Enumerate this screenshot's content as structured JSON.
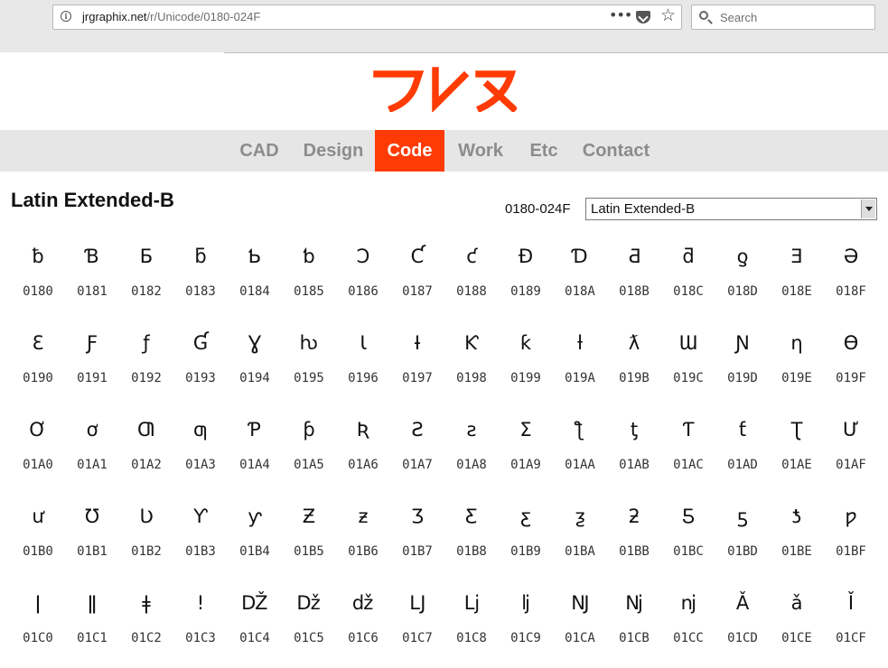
{
  "browser": {
    "url_host": "jrgraphix.net",
    "url_path": "/r/Unicode/0180-024F",
    "search_placeholder": "Search"
  },
  "brand": {
    "logo_text": "フレメ",
    "accent_color": "#ff3b05"
  },
  "nav": {
    "items": [
      {
        "label": "CAD"
      },
      {
        "label": "Design"
      },
      {
        "label": "Code"
      },
      {
        "label": "Work"
      },
      {
        "label": "Etc"
      },
      {
        "label": "Contact"
      }
    ],
    "active": "Code"
  },
  "page": {
    "title": "Latin Extended-B",
    "range_label": "0180-024F",
    "selected_block": "Latin Extended-B"
  },
  "chars": [
    {
      "glyph": "ƀ",
      "code": "0180"
    },
    {
      "glyph": "Ɓ",
      "code": "0181"
    },
    {
      "glyph": "Ƃ",
      "code": "0182"
    },
    {
      "glyph": "ƃ",
      "code": "0183"
    },
    {
      "glyph": "Ƅ",
      "code": "0184"
    },
    {
      "glyph": "ƅ",
      "code": "0185"
    },
    {
      "glyph": "Ɔ",
      "code": "0186"
    },
    {
      "glyph": "Ƈ",
      "code": "0187"
    },
    {
      "glyph": "ƈ",
      "code": "0188"
    },
    {
      "glyph": "Ɖ",
      "code": "0189"
    },
    {
      "glyph": "Ɗ",
      "code": "018A"
    },
    {
      "glyph": "Ƌ",
      "code": "018B"
    },
    {
      "glyph": "ƌ",
      "code": "018C"
    },
    {
      "glyph": "ƍ",
      "code": "018D"
    },
    {
      "glyph": "Ǝ",
      "code": "018E"
    },
    {
      "glyph": "Ə",
      "code": "018F"
    },
    {
      "glyph": "Ɛ",
      "code": "0190"
    },
    {
      "glyph": "Ƒ",
      "code": "0191"
    },
    {
      "glyph": "ƒ",
      "code": "0192"
    },
    {
      "glyph": "Ɠ",
      "code": "0193"
    },
    {
      "glyph": "Ɣ",
      "code": "0194"
    },
    {
      "glyph": "ƕ",
      "code": "0195"
    },
    {
      "glyph": "Ɩ",
      "code": "0196"
    },
    {
      "glyph": "Ɨ",
      "code": "0197"
    },
    {
      "glyph": "Ƙ",
      "code": "0198"
    },
    {
      "glyph": "ƙ",
      "code": "0199"
    },
    {
      "glyph": "ƚ",
      "code": "019A"
    },
    {
      "glyph": "ƛ",
      "code": "019B"
    },
    {
      "glyph": "Ɯ",
      "code": "019C"
    },
    {
      "glyph": "Ɲ",
      "code": "019D"
    },
    {
      "glyph": "ƞ",
      "code": "019E"
    },
    {
      "glyph": "Ɵ",
      "code": "019F"
    },
    {
      "glyph": "Ơ",
      "code": "01A0"
    },
    {
      "glyph": "ơ",
      "code": "01A1"
    },
    {
      "glyph": "Ƣ",
      "code": "01A2"
    },
    {
      "glyph": "ƣ",
      "code": "01A3"
    },
    {
      "glyph": "Ƥ",
      "code": "01A4"
    },
    {
      "glyph": "ƥ",
      "code": "01A5"
    },
    {
      "glyph": "Ʀ",
      "code": "01A6"
    },
    {
      "glyph": "Ƨ",
      "code": "01A7"
    },
    {
      "glyph": "ƨ",
      "code": "01A8"
    },
    {
      "glyph": "Ʃ",
      "code": "01A9"
    },
    {
      "glyph": "ƪ",
      "code": "01AA"
    },
    {
      "glyph": "ƫ",
      "code": "01AB"
    },
    {
      "glyph": "Ƭ",
      "code": "01AC"
    },
    {
      "glyph": "ƭ",
      "code": "01AD"
    },
    {
      "glyph": "Ʈ",
      "code": "01AE"
    },
    {
      "glyph": "Ư",
      "code": "01AF"
    },
    {
      "glyph": "ư",
      "code": "01B0"
    },
    {
      "glyph": "Ʊ",
      "code": "01B1"
    },
    {
      "glyph": "Ʋ",
      "code": "01B2"
    },
    {
      "glyph": "Ƴ",
      "code": "01B3"
    },
    {
      "glyph": "ƴ",
      "code": "01B4"
    },
    {
      "glyph": "Ƶ",
      "code": "01B5"
    },
    {
      "glyph": "ƶ",
      "code": "01B6"
    },
    {
      "glyph": "Ʒ",
      "code": "01B7"
    },
    {
      "glyph": "Ƹ",
      "code": "01B8"
    },
    {
      "glyph": "ƹ",
      "code": "01B9"
    },
    {
      "glyph": "ƺ",
      "code": "01BA"
    },
    {
      "glyph": "ƻ",
      "code": "01BB"
    },
    {
      "glyph": "Ƽ",
      "code": "01BC"
    },
    {
      "glyph": "ƽ",
      "code": "01BD"
    },
    {
      "glyph": "ƾ",
      "code": "01BE"
    },
    {
      "glyph": "ƿ",
      "code": "01BF"
    },
    {
      "glyph": "ǀ",
      "code": "01C0"
    },
    {
      "glyph": "ǁ",
      "code": "01C1"
    },
    {
      "glyph": "ǂ",
      "code": "01C2"
    },
    {
      "glyph": "ǃ",
      "code": "01C3"
    },
    {
      "glyph": "Ǆ",
      "code": "01C4"
    },
    {
      "glyph": "ǅ",
      "code": "01C5"
    },
    {
      "glyph": "ǆ",
      "code": "01C6"
    },
    {
      "glyph": "Ǉ",
      "code": "01C7"
    },
    {
      "glyph": "ǈ",
      "code": "01C8"
    },
    {
      "glyph": "ǉ",
      "code": "01C9"
    },
    {
      "glyph": "Ǌ",
      "code": "01CA"
    },
    {
      "glyph": "ǋ",
      "code": "01CB"
    },
    {
      "glyph": "ǌ",
      "code": "01CC"
    },
    {
      "glyph": "Ǎ",
      "code": "01CD"
    },
    {
      "glyph": "ǎ",
      "code": "01CE"
    },
    {
      "glyph": "Ǐ",
      "code": "01CF"
    }
  ]
}
